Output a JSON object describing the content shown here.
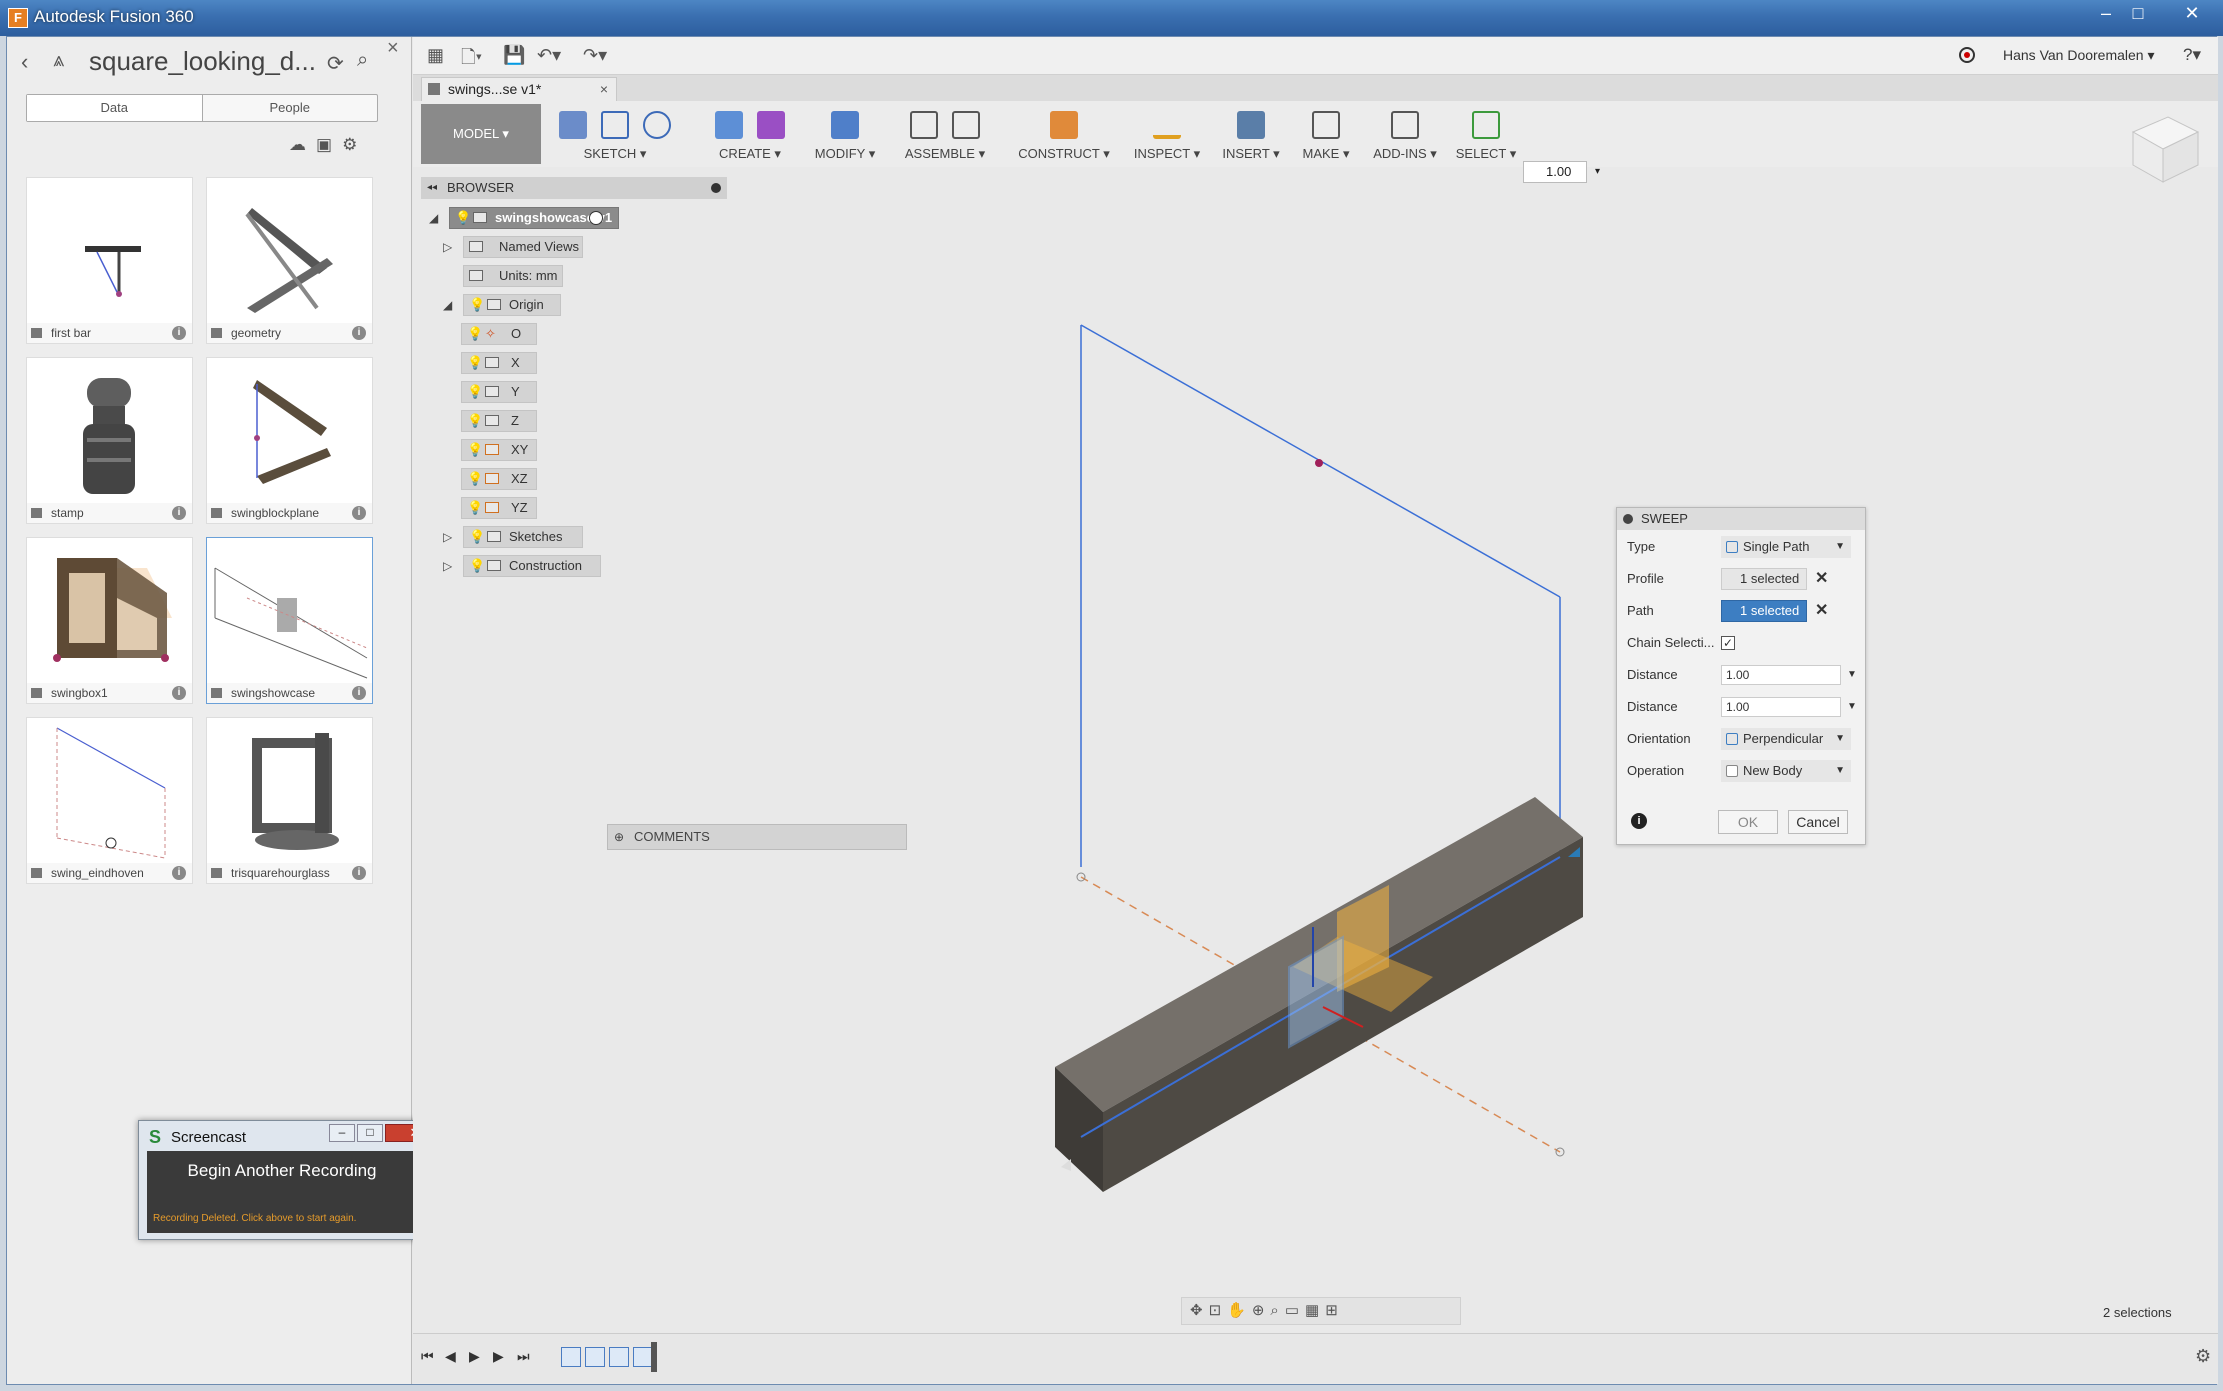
{
  "window": {
    "title": "Autodesk Fusion 360",
    "min": "–",
    "max": "□",
    "close": "✕"
  },
  "data_panel": {
    "project_name": "square_looking_d...",
    "tabs": [
      "Data",
      "People"
    ],
    "files": [
      {
        "name": "first bar"
      },
      {
        "name": "geometry"
      },
      {
        "name": "stamp"
      },
      {
        "name": "swingblockplane"
      },
      {
        "name": "swingbox1"
      },
      {
        "name": "swingshowcase"
      },
      {
        "name": "swing_eindhoven"
      },
      {
        "name": "trisquarehourglass"
      }
    ]
  },
  "screencast": {
    "title": "Screencast",
    "action": "Begin Another Recording",
    "note": "Recording Deleted. Click above to start again."
  },
  "qat": {
    "user": "Hans Van Dooremalen ▾"
  },
  "document_tab": {
    "label": "swings...se v1*"
  },
  "toolbar": {
    "workspace": "MODEL ▾",
    "groups": [
      {
        "label": "SKETCH ▾"
      },
      {
        "label": "CREATE ▾"
      },
      {
        "label": "MODIFY ▾"
      },
      {
        "label": "ASSEMBLE ▾"
      },
      {
        "label": "CONSTRUCT ▾"
      },
      {
        "label": "INSPECT ▾"
      },
      {
        "label": "INSERT ▾"
      },
      {
        "label": "MAKE ▾"
      },
      {
        "label": "ADD-INS ▾"
      },
      {
        "label": "SELECT ▾"
      }
    ],
    "scale_value": "1.00"
  },
  "browser": {
    "title": "BROWSER",
    "root": "swingshowcase v1",
    "nodes": {
      "named_views": "Named Views",
      "units": "Units: mm",
      "origin": "Origin",
      "o": "O",
      "x": "X",
      "y": "Y",
      "z": "Z",
      "xy": "XY",
      "xz": "XZ",
      "yz": "YZ",
      "sketches": "Sketches",
      "construction": "Construction"
    }
  },
  "comments": {
    "label": "COMMENTS"
  },
  "sweep": {
    "title": "SWEEP",
    "rows": {
      "type": {
        "label": "Type",
        "value": "Single Path"
      },
      "profile": {
        "label": "Profile",
        "value": "1 selected"
      },
      "path": {
        "label": "Path",
        "value": "1 selected"
      },
      "chain": {
        "label": "Chain Selecti...",
        "checked": true
      },
      "distance1": {
        "label": "Distance",
        "value": "1.00"
      },
      "distance2": {
        "label": "Distance",
        "value": "1.00"
      },
      "orientation": {
        "label": "Orientation",
        "value": "Perpendicular"
      },
      "operation": {
        "label": "Operation",
        "value": "New Body"
      }
    },
    "ok": "OK",
    "cancel": "Cancel"
  },
  "status": {
    "selections": "2 selections"
  },
  "colors": {
    "accent": "#3d7ec2",
    "titlebar": "#3a6fb0",
    "sketch_line": "#3b6fd6",
    "body": "#5e5a52",
    "plane": "#f4b43e"
  }
}
